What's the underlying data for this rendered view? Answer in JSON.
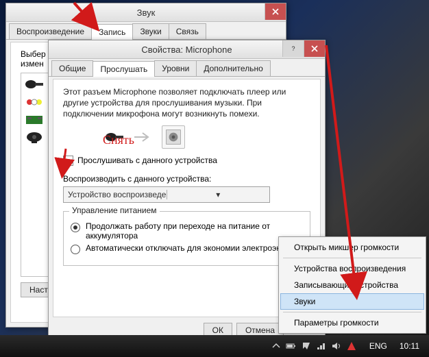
{
  "sound_window": {
    "title": "Звук",
    "tabs": [
      "Воспроизведение",
      "Запись",
      "Звуки",
      "Связь"
    ],
    "active_tab": 1,
    "left_label": "Выбер\nизмен",
    "btn_settings": "Настр"
  },
  "prop_window": {
    "title": "Свойства: Microphone",
    "tabs": [
      "Общие",
      "Прослушать",
      "Уровни",
      "Дополнительно"
    ],
    "active_tab": 1,
    "description": "Этот разъем Microphone позволяет подключать плеер или другие устройства для прослушивания музыки. При подключении микрофона могут возникнуть помехи.",
    "listen_checkbox": "Прослушивать с данного устройства",
    "listen_checked": false,
    "playback_label": "Воспроизводить с данного устройства:",
    "playback_value": "Устройство воспроизведения по умолчанию",
    "power_group": "Управление питанием",
    "power_opt1": "Продолжать работу при переходе на питание от аккумулятора",
    "power_opt2": "Автоматически отключать для экономии электроэне",
    "power_selected": 0,
    "btn_ok": "ОК",
    "btn_cancel": "Отмена"
  },
  "context_menu": {
    "items": [
      "Открыть микшер громкости",
      "Устройства воспроизведения",
      "Записывающие устройства",
      "Звуки",
      "Параметры громкости"
    ],
    "highlighted": 3
  },
  "taskbar": {
    "lang": "ENG",
    "time": "10:11"
  },
  "annotations": {
    "remove_label": "Снять"
  },
  "colors": {
    "arrow": "#d11a1a"
  }
}
